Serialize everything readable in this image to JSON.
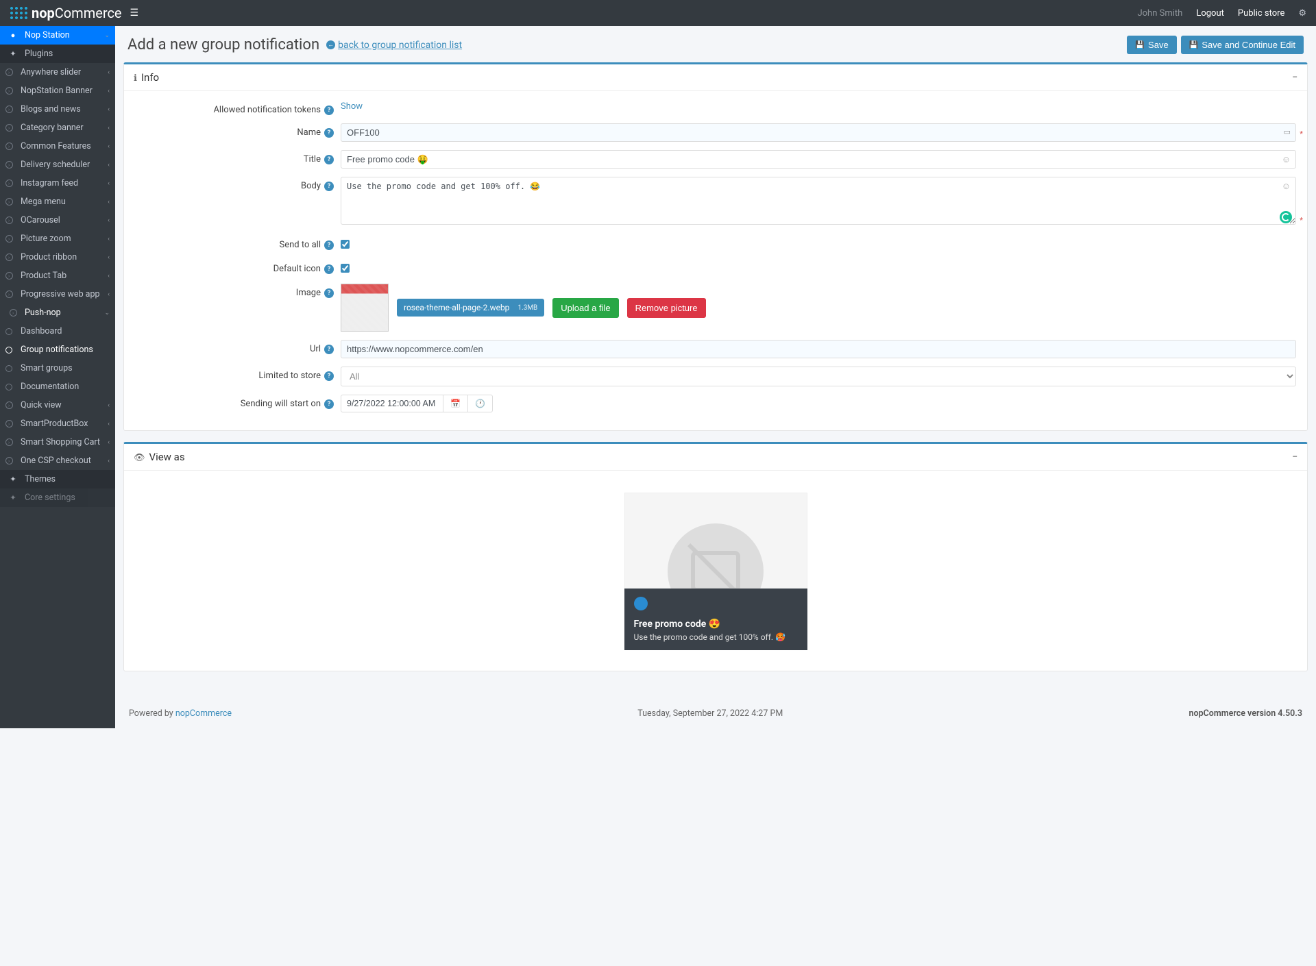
{
  "header": {
    "brand_bold": "nop",
    "brand_rest": "Commerce",
    "user": "John Smith",
    "logout": "Logout",
    "public_store": "Public store"
  },
  "sidebar": {
    "root": "Nop Station",
    "plugins": "Plugins",
    "items": [
      "Anywhere slider",
      "NopStation Banner",
      "Blogs and news",
      "Category banner",
      "Common Features",
      "Delivery scheduler",
      "Instagram feed",
      "Mega menu",
      "OCarousel",
      "Picture zoom",
      "Product ribbon",
      "Product Tab",
      "Progressive web app"
    ],
    "pushnop": "Push-nop",
    "push_sub": [
      "Dashboard",
      "Group notifications",
      "Smart groups",
      "Documentation"
    ],
    "items2": [
      "Quick view",
      "SmartProductBox",
      "Smart Shopping Cart",
      "One CSP checkout"
    ],
    "themes": "Themes",
    "core": "Core settings"
  },
  "page": {
    "title": "Add a new group notification",
    "back": "back to group notification list",
    "save": "Save",
    "save_continue": "Save and Continue Edit"
  },
  "panels": {
    "info": "Info",
    "view_as": "View as"
  },
  "form": {
    "allowed_tokens": "Allowed notification tokens",
    "show": "Show",
    "name_label": "Name",
    "name_value": "OFF100",
    "title_label": "Title",
    "title_value": "Free promo code 🤑",
    "body_label": "Body",
    "body_value": "Use the promo code and get 100% off. 😂",
    "send_all": "Send to all",
    "default_icon": "Default icon",
    "image": "Image",
    "file_name": "rosea-theme-all-page-2.webp",
    "file_size": "1.3MB",
    "upload": "Upload a file",
    "remove_pic": "Remove picture",
    "url_label": "Url",
    "url_value": "https://www.nopcommerce.com/en",
    "limited_store": "Limited to store",
    "store_value": "All",
    "sending_start": "Sending will start on",
    "sending_value": "9/27/2022 12:00:00 AM"
  },
  "preview": {
    "title": "Free promo code 😍",
    "body": "Use the promo code and get 100% off. 🥵"
  },
  "footer": {
    "powered": "Powered by ",
    "nop": "nopCommerce",
    "datetime": "Tuesday, September 27, 2022 4:27 PM",
    "version": "nopCommerce version 4.50.3"
  }
}
